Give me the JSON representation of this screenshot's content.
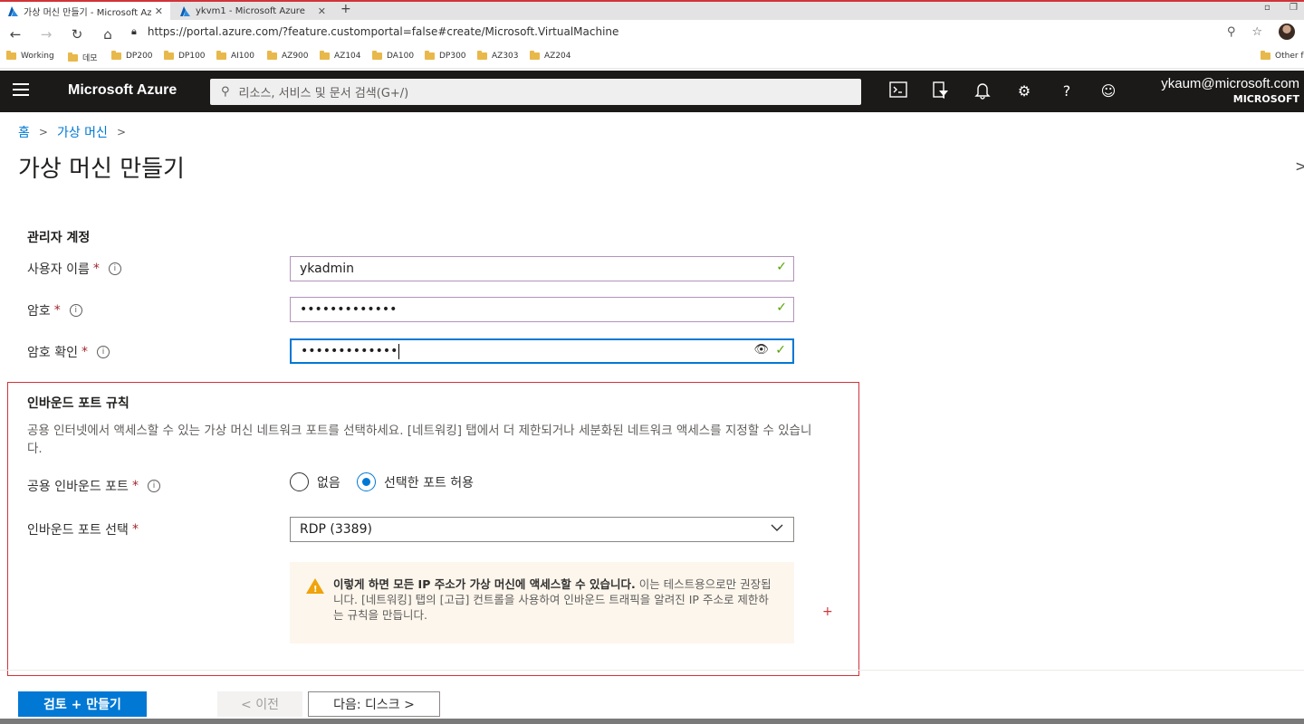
{
  "browser": {
    "tabs": [
      {
        "title": "가상 머신 만들기 - Microsoft Az",
        "icon": "azure-icon",
        "active": true
      },
      {
        "title": "ykvm1 - Microsoft Azure",
        "icon": "azure-icon",
        "active": false
      }
    ],
    "url": "https://portal.azure.com/?feature.customportal=false#create/Microsoft.VirtualMachine",
    "bookmarks": [
      "Working",
      "데모",
      "DP200",
      "DP100",
      "AI100",
      "AZ900",
      "AZ104",
      "DA100",
      "DP300",
      "AZ303",
      "AZ204"
    ],
    "other_bookmarks": "Other f"
  },
  "header": {
    "brand": "Microsoft Azure",
    "search_placeholder": "리소스, 서비스 및 문서 검색(G+/)",
    "user_email": "ykaum@microsoft.com",
    "user_org": "MICROSOFT"
  },
  "breadcrumb": [
    "홈",
    "가상 머신"
  ],
  "page_title": "가상 머신 만들기",
  "admin": {
    "heading": "관리자 계정",
    "username_label": "사용자 이름",
    "username_value": "ykadmin",
    "password_label": "암호",
    "password_value": "•••••••••••••",
    "confirm_label": "암호 확인",
    "confirm_value": "•••••••••••••"
  },
  "inbound": {
    "heading": "인바운드 포트 규칙",
    "description": "공용 인터넷에서 액세스할 수 있는 가상 머신 네트워크 포트를 선택하세요. [네트워킹] 탭에서 더 제한되거나 세분화된 네트워크 액세스를 지정할 수 있습니다.",
    "public_ports_label": "공용 인바운드 포트",
    "option_none": "없음",
    "option_allow": "선택한 포트 허용",
    "selected_option": "option_allow",
    "select_label": "인바운드 포트 선택",
    "select_value": "RDP (3389)",
    "warning_bold": "이렇게 하면 모든 IP 주소가 가상 머신에 액세스할 수 있습니다.",
    "warning_text": " 이는 테스트용으로만 권장됩니다. [네트워킹] 탭의 [고급] 컨트롤을 사용하여 인바운드 트래픽을 알려진 IP 주소로 제한하는 규칙을 만듭니다."
  },
  "footer": {
    "review_button": "검토 + 만들기",
    "prev_button": "< 이전",
    "next_button": "다음: 디스크 >"
  },
  "colors": {
    "accent": "#0078d4",
    "header_bg": "#1b1a19",
    "required": "#a4262c",
    "highlight_box": "#d13438",
    "valid_check": "#57a300",
    "warning_icon": "#f0a30a"
  }
}
